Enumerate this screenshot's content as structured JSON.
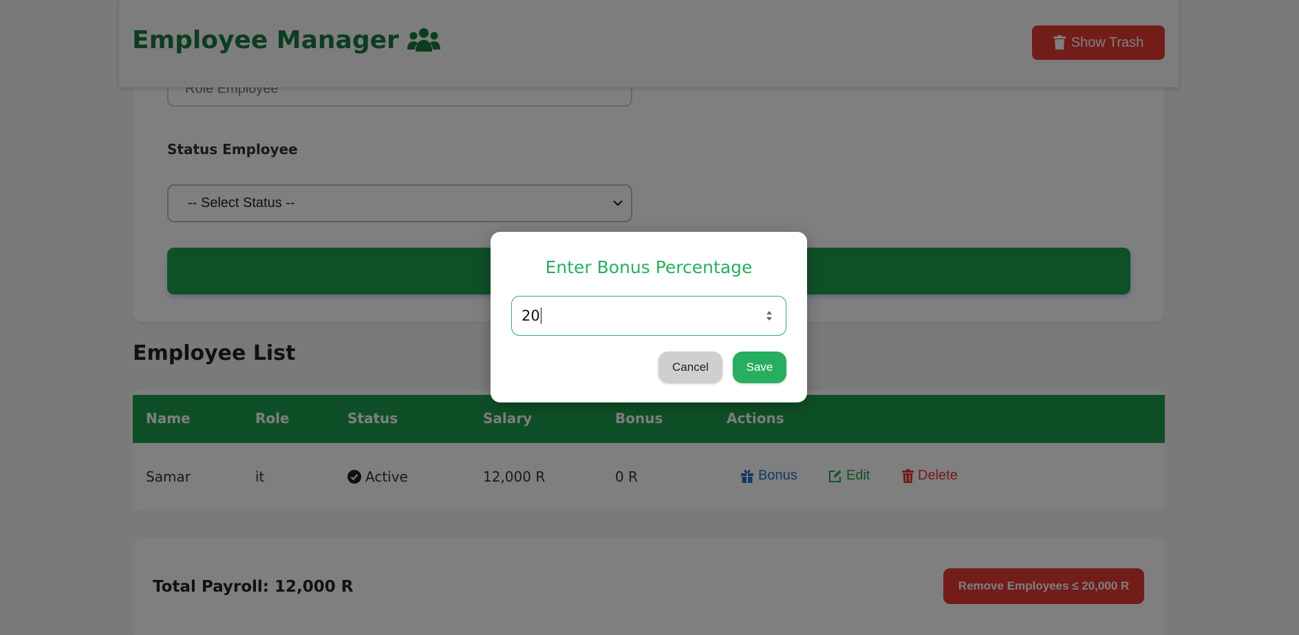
{
  "header": {
    "title": "Employee Manager",
    "show_trash_label": "Show Trash"
  },
  "form": {
    "role_placeholder": "Role Employee",
    "status_label": "Status Employee",
    "status_selected": "-- Select Status --"
  },
  "list": {
    "title": "Employee List",
    "columns": [
      "Name",
      "Role",
      "Status",
      "Salary",
      "Bonus",
      "Actions"
    ],
    "rows": [
      {
        "name": "Samar",
        "role": "it",
        "status": "Active",
        "salary": "12,000 R",
        "bonus": "0 R",
        "actions": {
          "bonus": "Bonus",
          "edit": "Edit",
          "delete": "Delete"
        }
      }
    ]
  },
  "payroll": {
    "total_label": "Total Payroll: 12,000 R",
    "remove_label": "Remove Employees ≤ 20,000 R"
  },
  "modal": {
    "title": "Enter Bonus Percentage",
    "input_value": "20",
    "cancel_label": "Cancel",
    "save_label": "Save"
  },
  "colors": {
    "brand_green": "#1b7a3e",
    "accent_green": "#27ae60",
    "danger_red": "#e53b34",
    "link_blue": "#2574c8"
  }
}
